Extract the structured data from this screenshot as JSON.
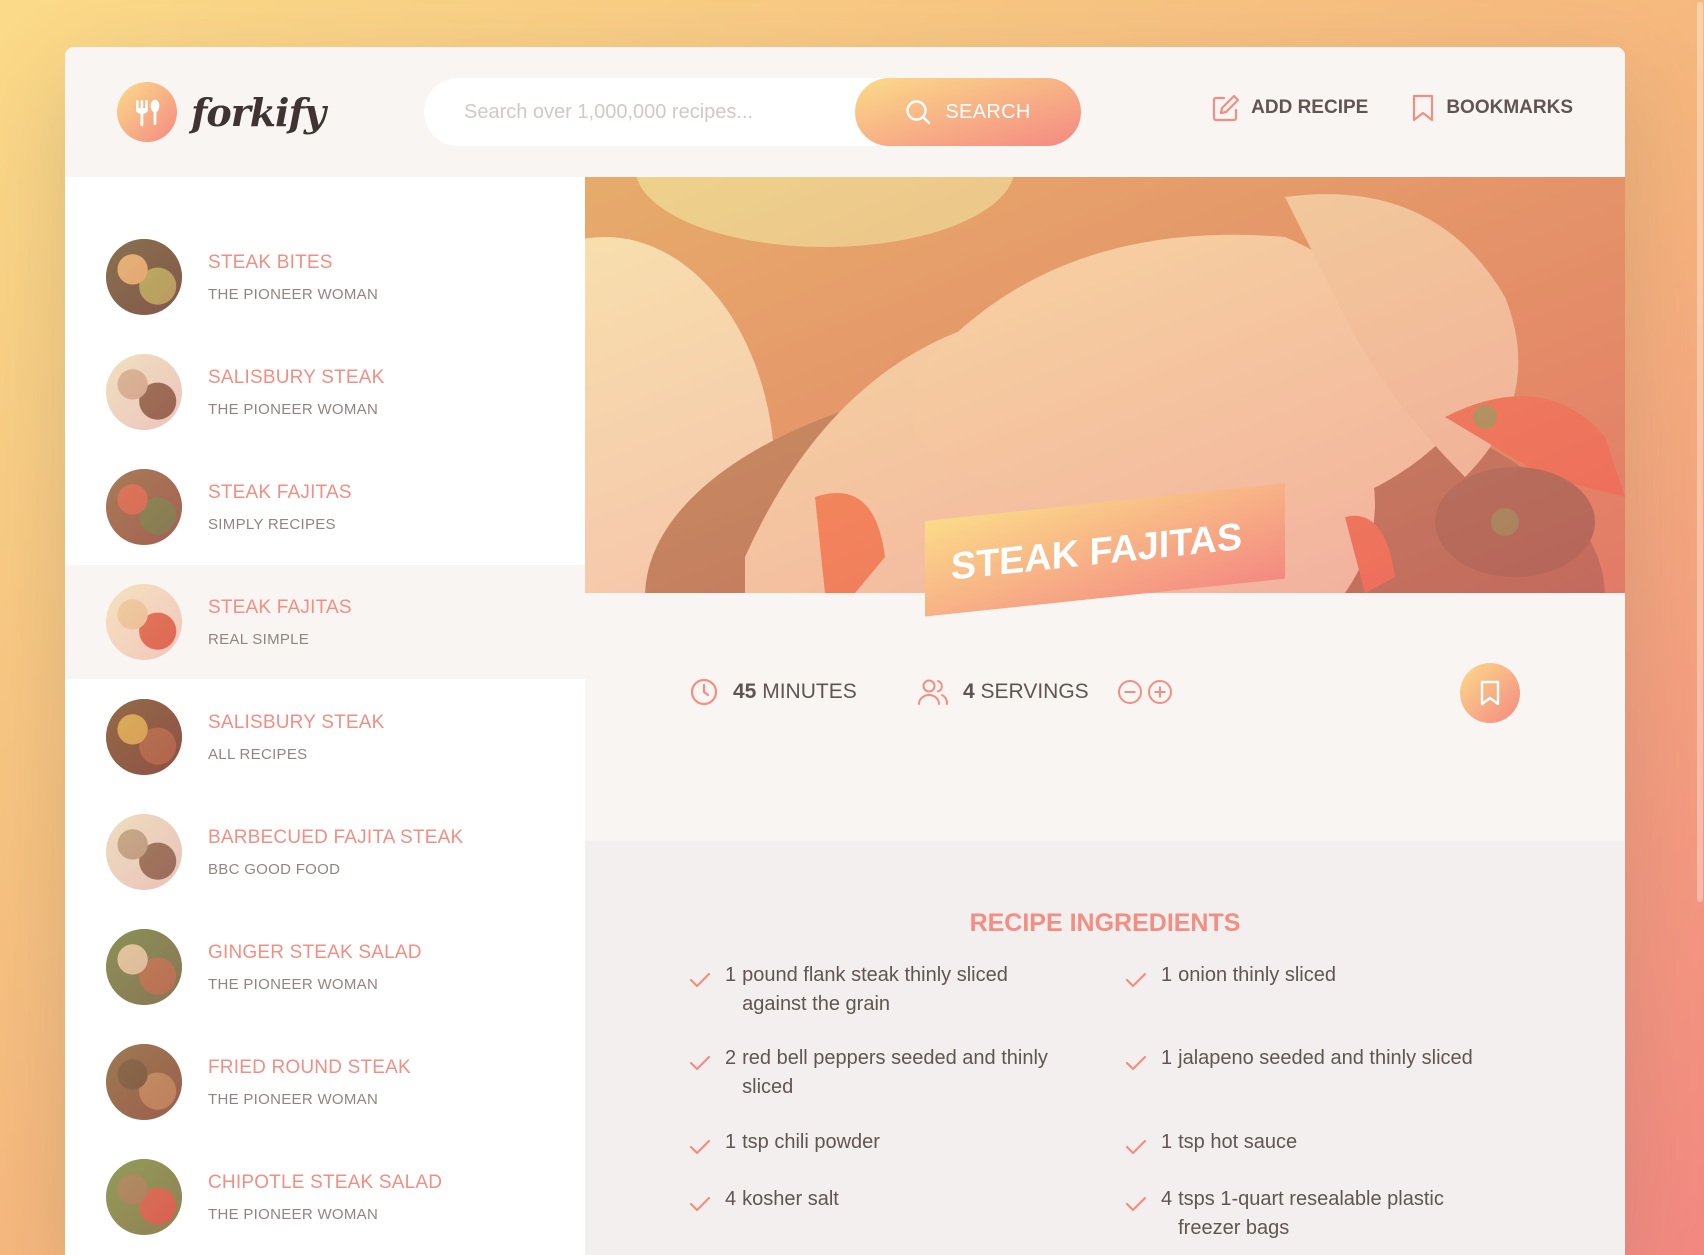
{
  "app": {
    "logo_text": "forkify",
    "logo_icon": "fork-spoon-icon"
  },
  "search": {
    "placeholder": "Search over 1,000,000 recipes...",
    "value": "",
    "button_label": "SEARCH"
  },
  "nav": {
    "add_recipe": "ADD RECIPE",
    "bookmarks": "BOOKMARKS"
  },
  "results": [
    {
      "title": "STEAK BITES",
      "publisher": "THE PIONEER WOMAN",
      "active": false,
      "thumb_colors": [
        "#4a3a2e",
        "#9aa04e",
        "#d9a46a"
      ]
    },
    {
      "title": "SALISBURY STEAK",
      "publisher": "THE PIONEER WOMAN",
      "active": false,
      "thumb_colors": [
        "#e9e3dc",
        "#6b4a3c",
        "#c8a79a"
      ]
    },
    {
      "title": "STEAK FAJITAS",
      "publisher": "SIMPLY RECIPES",
      "active": false,
      "thumb_colors": [
        "#7a4a3a",
        "#4f6b3a",
        "#c84a3e"
      ]
    },
    {
      "title": "STEAK FAJITAS",
      "publisher": "REAL SIMPLE",
      "active": true,
      "thumb_colors": [
        "#f1e6dc",
        "#d3513e",
        "#e9c9a8"
      ]
    },
    {
      "title": "SALISBURY STEAK",
      "publisher": "ALL RECIPES",
      "active": false,
      "thumb_colors": [
        "#5a3024",
        "#8f4b30",
        "#c89a3e"
      ]
    },
    {
      "title": "BARBECUED FAJITA STEAK",
      "publisher": "BBC GOOD FOOD",
      "active": false,
      "thumb_colors": [
        "#e6dfd9",
        "#6e5648",
        "#a89585"
      ]
    },
    {
      "title": "GINGER STEAK SALAD",
      "publisher": "THE PIONEER WOMAN",
      "active": false,
      "thumb_colors": [
        "#4f6a3c",
        "#9b5a3c",
        "#d2c2a8"
      ]
    },
    {
      "title": "FRIED ROUND STEAK",
      "publisher": "THE PIONEER WOMAN",
      "active": false,
      "thumb_colors": [
        "#6b4632",
        "#a3744c",
        "#4b3426"
      ]
    },
    {
      "title": "CHIPOTLE STEAK SALAD",
      "publisher": "THE PIONEER WOMAN",
      "active": false,
      "thumb_colors": [
        "#5b7a3e",
        "#c8463a",
        "#8a6a4c"
      ]
    }
  ],
  "recipe": {
    "title": "STEAK FAJITAS",
    "cooking_time": "45",
    "cooking_time_unit": "MINUTES",
    "servings": "4",
    "servings_unit": "SERVINGS",
    "ingredients_heading": "RECIPE INGREDIENTS",
    "ingredients": [
      {
        "qty": "1",
        "desc": "pound flank steak thinly sliced against the grain"
      },
      {
        "qty": "1",
        "desc": "onion thinly sliced"
      },
      {
        "qty": "2",
        "desc": "red bell peppers seeded and thinly sliced"
      },
      {
        "qty": "1",
        "desc": "jalapeno seeded and thinly sliced"
      },
      {
        "qty": "1",
        "desc": "tsp chili powder"
      },
      {
        "qty": "1",
        "desc": "tsp hot sauce"
      },
      {
        "qty": "4",
        "desc": "kosher salt"
      },
      {
        "qty": "4",
        "desc": "tsps 1-quart resealable plastic freezer bags"
      }
    ]
  },
  "colors": {
    "accent": "#f38e82",
    "gradient_start": "#fbdb89",
    "gradient_end": "#f48982",
    "text": "#615551"
  }
}
